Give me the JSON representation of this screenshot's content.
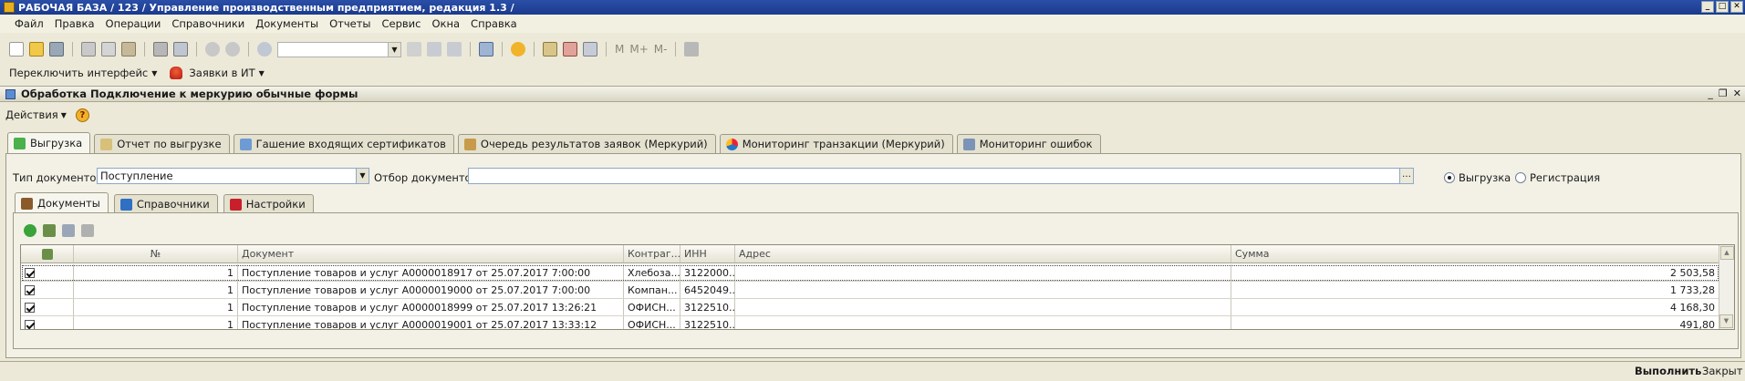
{
  "window": {
    "title": "РАБОЧАЯ БАЗА / 123 /  Управление производственным предприятием, редакция 1.3 /"
  },
  "menu": [
    "Файл",
    "Правка",
    "Операции",
    "Справочники",
    "Документы",
    "Отчеты",
    "Сервис",
    "Окна",
    "Справка"
  ],
  "toolbar": {
    "memory": [
      "M",
      "M+",
      "M-"
    ]
  },
  "toolbar2": {
    "switch_interface": "Переключить интерфейс",
    "it_requests": "Заявки в ИТ"
  },
  "form": {
    "title": "Обработка  Подключение к меркурию обычные формы",
    "actions": "Действия"
  },
  "tabs": [
    {
      "label": "Выгрузка"
    },
    {
      "label": "Отчет по выгрузке"
    },
    {
      "label": "Гашение входящих сертификатов"
    },
    {
      "label": "Очередь результатов заявок (Меркурий)"
    },
    {
      "label": "Мониторинг транзакции (Меркурий)"
    },
    {
      "label": "Мониторинг ошибок"
    }
  ],
  "filters": {
    "doc_type_label": "Тип документов:",
    "doc_type_value": "Поступление",
    "doc_filter_label": "Отбор документов:",
    "doc_filter_value": "",
    "mode_options": [
      "Выгрузка",
      "Регистрация"
    ],
    "mode_selected": "Выгрузка"
  },
  "subtabs": [
    {
      "label": "Документы"
    },
    {
      "label": "Справочники"
    },
    {
      "label": "Настройки"
    }
  ],
  "table": {
    "columns": [
      "",
      "№",
      "Документ",
      "Контраг...",
      "ИНН",
      "Адрес",
      "Сумма"
    ],
    "rows": [
      {
        "checked": true,
        "num": "1",
        "doc": "Поступление товаров и услуг А0000018917 от 25.07.2017 7:00:00",
        "contractor": "Хлебоза...",
        "inn": "3122000...",
        "address": "",
        "sum": "2 503,58"
      },
      {
        "checked": true,
        "num": "1",
        "doc": "Поступление товаров и услуг А0000019000 от 25.07.2017 7:00:00",
        "contractor": "Компан...",
        "inn": "6452049...",
        "address": "",
        "sum": "1 733,28"
      },
      {
        "checked": true,
        "num": "1",
        "doc": "Поступление товаров и услуг А0000018999 от 25.07.2017 13:26:21",
        "contractor": "ОФИСН...",
        "inn": "3122510...",
        "address": "",
        "sum": "4 168,30"
      },
      {
        "checked": true,
        "num": "1",
        "doc": "Поступление товаров и услуг А0000019001 от 25.07.2017 13:33:12",
        "contractor": "ОФИСН...",
        "inn": "3122510...",
        "address": "",
        "sum": "491,80"
      }
    ]
  },
  "footer": {
    "execute": "Выполнить",
    "close": "Закрыт"
  }
}
